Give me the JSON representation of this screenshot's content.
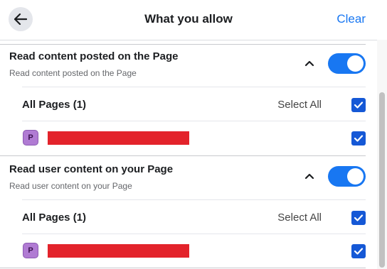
{
  "header": {
    "title": "What you allow",
    "clear_label": "Clear"
  },
  "permissions": [
    {
      "title": "Read content posted on the Page",
      "description": "Read content posted on the Page",
      "toggle_on": true,
      "pages_label": "All Pages (1)",
      "select_all_label": "Select All",
      "select_all_checked": true,
      "page_item": {
        "avatar_letter": "P",
        "checked": true
      }
    },
    {
      "title": "Read user content on your Page",
      "description": "Read user content on your Page",
      "toggle_on": true,
      "pages_label": "All Pages (1)",
      "select_all_label": "Select All",
      "select_all_checked": true,
      "page_item": {
        "avatar_letter": "P",
        "checked": true
      }
    }
  ],
  "colors": {
    "accent": "#1877f2",
    "checkbox": "#1558d6",
    "redaction": "#e3232b",
    "avatar": "#b07bd3"
  }
}
